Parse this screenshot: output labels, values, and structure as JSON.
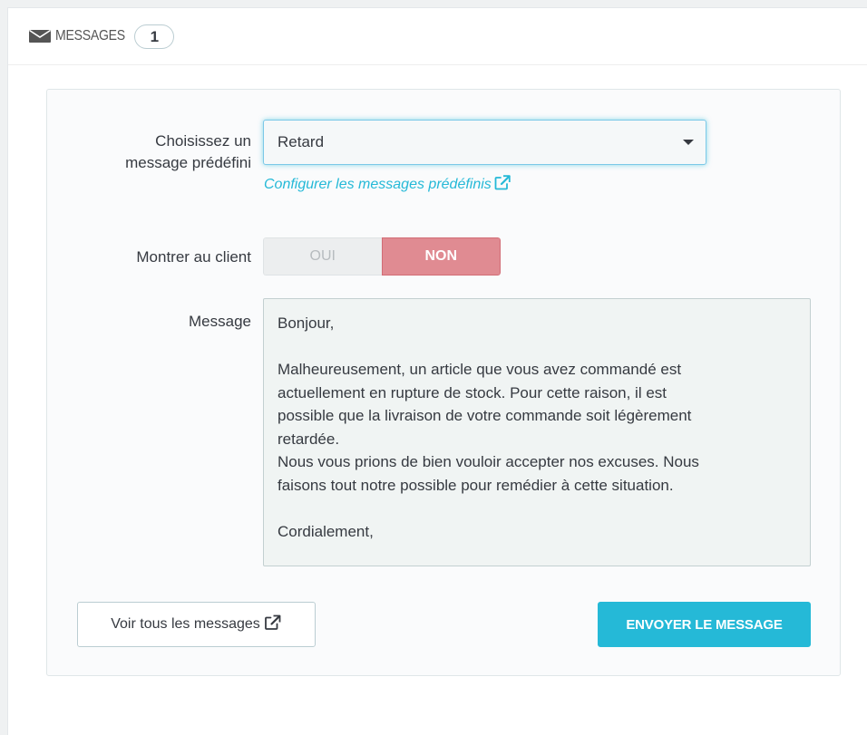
{
  "panel": {
    "title": "MESSAGES",
    "count": "1",
    "icon": "envelope-icon"
  },
  "form": {
    "predefined_label_line1": "Choisissez un",
    "predefined_label_line2": "message prédéfini",
    "predefined_selected": "Retard",
    "configure_link": "Configurer les messages prédéfinis",
    "show_client_label": "Montrer au client",
    "switch_yes": "OUI",
    "switch_no": "NON",
    "switch_value": "NON",
    "message_label": "Message",
    "message_lines": [
      "Bonjour,",
      "",
      "Malheureusement, un article que vous avez commandé est",
      "actuellement en rupture de stock. Pour cette raison, il est",
      "possible que la livraison de votre commande soit légèrement",
      "retardée.",
      "Nous vous prions de bien vouloir accepter nos excuses. Nous",
      "faisons tout notre possible pour remédier à cette situation.",
      "",
      "Cordialement,"
    ]
  },
  "actions": {
    "view_all": "Voir tous les messages",
    "send": "ENVOYER LE MESSAGE"
  },
  "colors": {
    "primary": "#25b9d7",
    "danger_switch": "#e08b92",
    "text": "#363a41"
  }
}
